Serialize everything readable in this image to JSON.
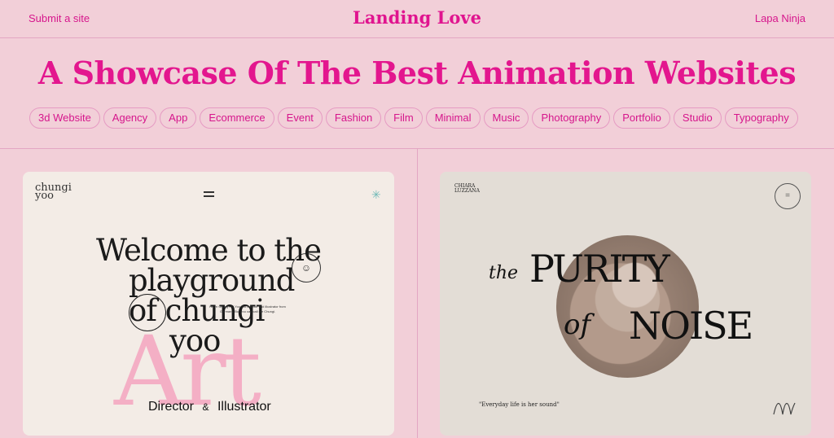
{
  "header": {
    "submit_label": "Submit a site",
    "brand": "Landing Love",
    "partner_link": "Lapa Ninja"
  },
  "hero": {
    "title": "A Showcase Of The Best Animation Websites"
  },
  "tags": [
    "3d Website",
    "Agency",
    "App",
    "Ecommerce",
    "Event",
    "Fashion",
    "Film",
    "Minimal",
    "Music",
    "Photography",
    "Portfolio",
    "Studio",
    "Typography"
  ],
  "cards": [
    {
      "logo": "chungi yoo",
      "welcome_lines": [
        "Welcome to the",
        "playground",
        "of chungi",
        "yoo"
      ],
      "overlay_word": "Art",
      "role_left": "Director",
      "role_amp": "&",
      "role_right": "Illustrator",
      "intro": "Hi I'm Chung Hui Yoo. Art director and illustrator from Germany. But you can call me Chungi."
    },
    {
      "logo": "CHIARA LUZZANA",
      "the": "the",
      "purity": "PURITY",
      "of": "of",
      "noise": "NOISE",
      "quote": "\"Everyday life is her sound\""
    }
  ],
  "colors": {
    "background": "#f2cfd8",
    "accent": "#e0148f",
    "border": "#e3a6c3"
  }
}
